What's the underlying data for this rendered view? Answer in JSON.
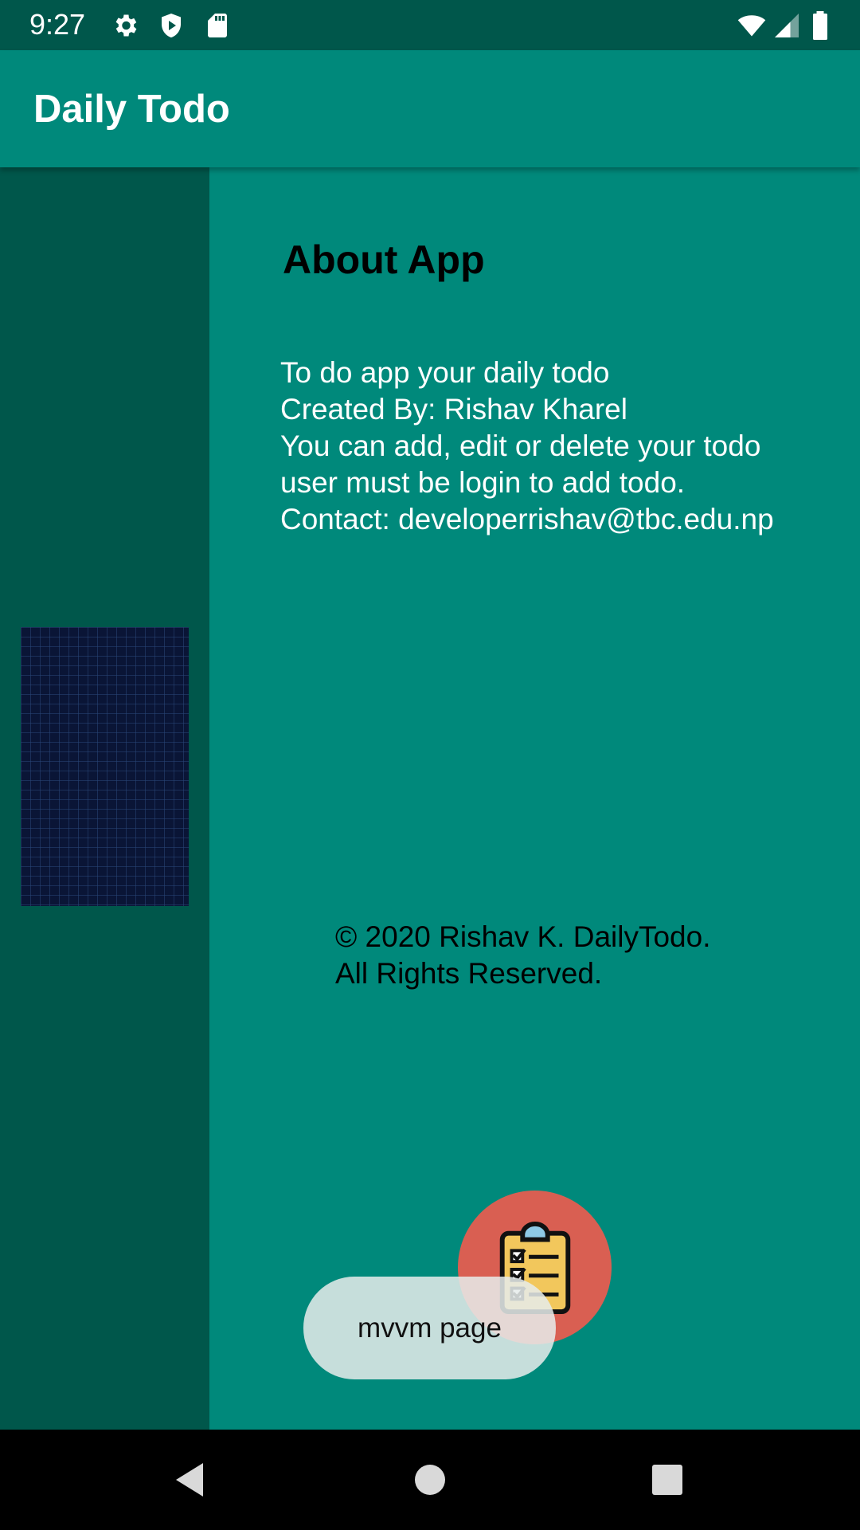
{
  "status_bar": {
    "time": "9:27",
    "left_icons": [
      "gear-icon",
      "shield-icon",
      "sd-card-icon"
    ],
    "right_icons": [
      "wifi-icon",
      "signal-icon",
      "battery-icon"
    ]
  },
  "app_bar": {
    "title": "Daily Todo"
  },
  "about": {
    "title": "About App",
    "lines": [
      "To do app your daily todo",
      "Created By: Rishav Kharel",
      "You can add, edit or delete your todo",
      "user must be login to add todo.",
      "Contact: developerrishav@tbc.edu.np"
    ]
  },
  "copyright": {
    "line1": "© 2020 Rishav K. DailyTodo.",
    "line2": "All Rights Reserved."
  },
  "fab": {
    "icon": "clipboard-checklist-icon"
  },
  "toast": {
    "message": "mvvm page"
  },
  "nav_bar": {
    "buttons": [
      "back-icon",
      "home-icon",
      "recents-icon"
    ]
  },
  "colors": {
    "primary": "#00897b",
    "primary_dark": "#00574b",
    "fab": "#d95f52",
    "text_white": "#ffffff",
    "text_black": "#000000"
  }
}
